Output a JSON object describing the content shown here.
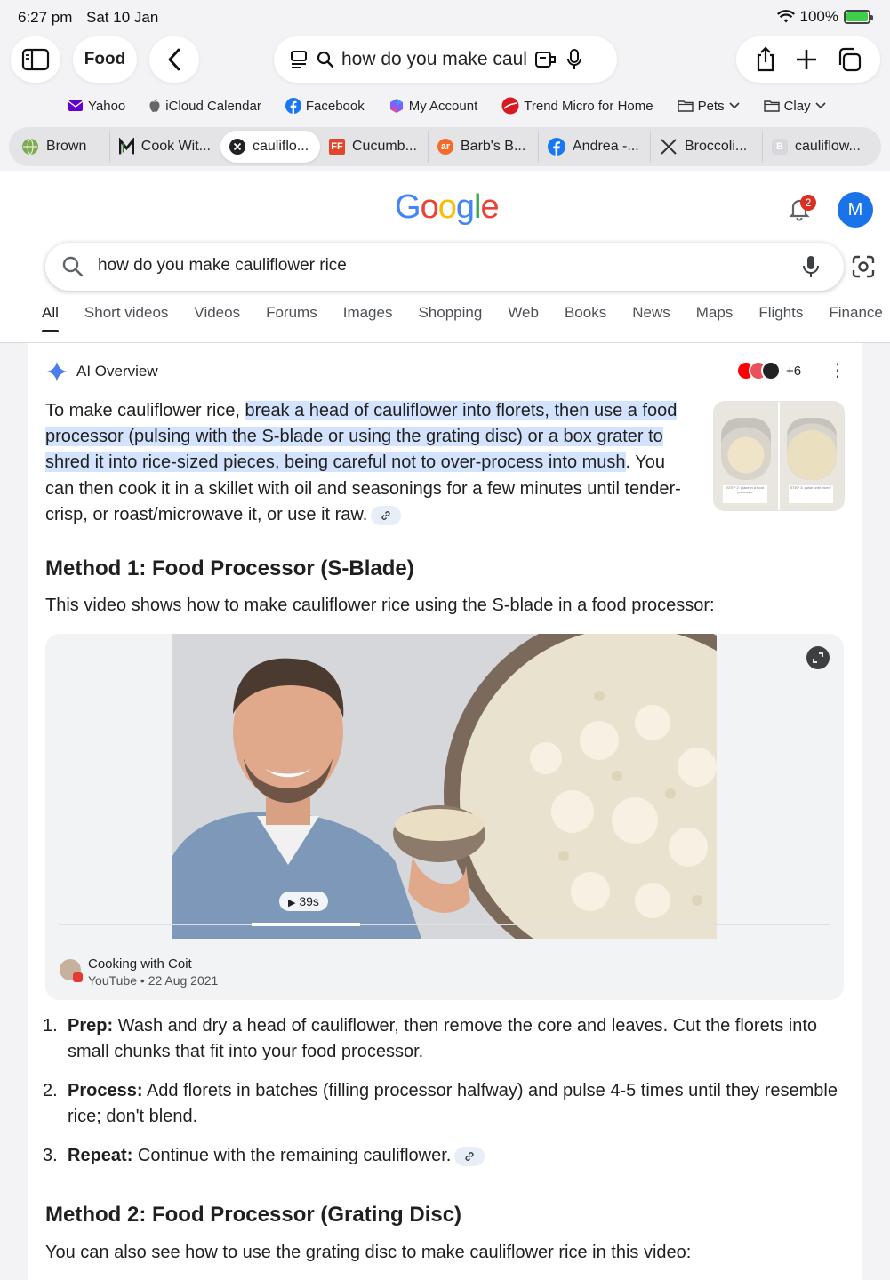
{
  "status": {
    "time": "6:27 pm",
    "date": "Sat 10 Jan",
    "battery": "100%",
    "battery_level": 1.0
  },
  "toolbar": {
    "tab_group": "Food",
    "address": "how do you make cauliflower rice"
  },
  "bookmarks": [
    {
      "label": "Yahoo",
      "icon": "yahoo-mail-icon",
      "color": "#6001d2"
    },
    {
      "label": "iCloud Calendar",
      "icon": "apple-icon",
      "color": "#555555"
    },
    {
      "label": "Facebook",
      "icon": "facebook-icon",
      "color": "#1877f2"
    },
    {
      "label": "My Account",
      "icon": "microsoft-icon",
      "color": "#7b61ff"
    },
    {
      "label": "Trend Micro for Home",
      "icon": "trend-micro-icon",
      "color": "#d71921"
    },
    {
      "label": "Pets",
      "icon": "folder-icon",
      "color": "#333333"
    },
    {
      "label": "Clay",
      "icon": "folder-icon",
      "color": "#333333"
    }
  ],
  "tabs": [
    {
      "label": "Brown",
      "icon": "globe-icon",
      "color": "#6a9a4a"
    },
    {
      "label": "Cook Wit...",
      "icon": "m-logo-icon",
      "color": "#1b1b1b"
    },
    {
      "label": "cauliflo...",
      "icon": "close-icon",
      "color": "#202124"
    },
    {
      "label": "Cucumb...",
      "icon": "ff-logo-icon",
      "color": "#e0462b"
    },
    {
      "label": "Barb's B...",
      "icon": "ar-logo-icon",
      "color": "#f26b2b"
    },
    {
      "label": "Andrea -...",
      "icon": "facebook-icon",
      "color": "#1877f2"
    },
    {
      "label": "Broccoli...",
      "icon": "utensils-icon",
      "color": "#333333"
    },
    {
      "label": "cauliflow...",
      "icon": "b-logo-icon",
      "color": "#c9cbd1"
    }
  ],
  "google": {
    "logo": "Google",
    "notifications": "2",
    "avatar_initial": "M",
    "query": "how do you make cauliflower rice",
    "nav": [
      "All",
      "Short videos",
      "Videos",
      "Forums",
      "Images",
      "Shopping",
      "Web",
      "Books",
      "News",
      "Maps",
      "Flights",
      "Finance"
    ]
  },
  "ai": {
    "heading": "AI Overview",
    "sources_more": "+6",
    "intro_pre": "To make cauliflower rice, ",
    "intro_highlight": "break a head of cauliflower into florets, then use a food processor (pulsing with the S-blade or using the grating disc) or a box grater to shred it into rice-sized pieces, being careful not to over-process into mush",
    "intro_post": ". You can then cook it in a skillet with oil and seasonings for a few minutes until tender-crisp, or roast/microwave it, or use it raw.",
    "thumb1_label": "STEP 2: place in a food processor",
    "thumb2_label": "STEP 3: pulse until \"riced\"",
    "method1_title": "Method 1: Food Processor (S-Blade)",
    "method1_intro": "This video shows how to make cauliflower rice using the S-blade in a food processor:",
    "video": {
      "duration": "39s",
      "progress": 0.14,
      "channel": "Cooking with Coit",
      "meta": "YouTube • 22 Aug 2021"
    },
    "steps": [
      {
        "num": "1.",
        "title": "Prep:",
        "text": " Wash and dry a head of cauliflower, then remove the core and leaves. Cut the florets into small chunks that fit into your food processor."
      },
      {
        "num": "2.",
        "title": "Process:",
        "text": " Add florets in batches (filling processor halfway) and pulse 4-5 times until they resemble rice; don't blend."
      },
      {
        "num": "3.",
        "title": "Repeat:",
        "text": " Continue with the remaining cauliflower."
      }
    ],
    "method2_title": "Method 2: Food Processor (Grating Disc)",
    "method2_intro": "You can also see how to use the grating disc to make cauliflower rice in this video:"
  }
}
